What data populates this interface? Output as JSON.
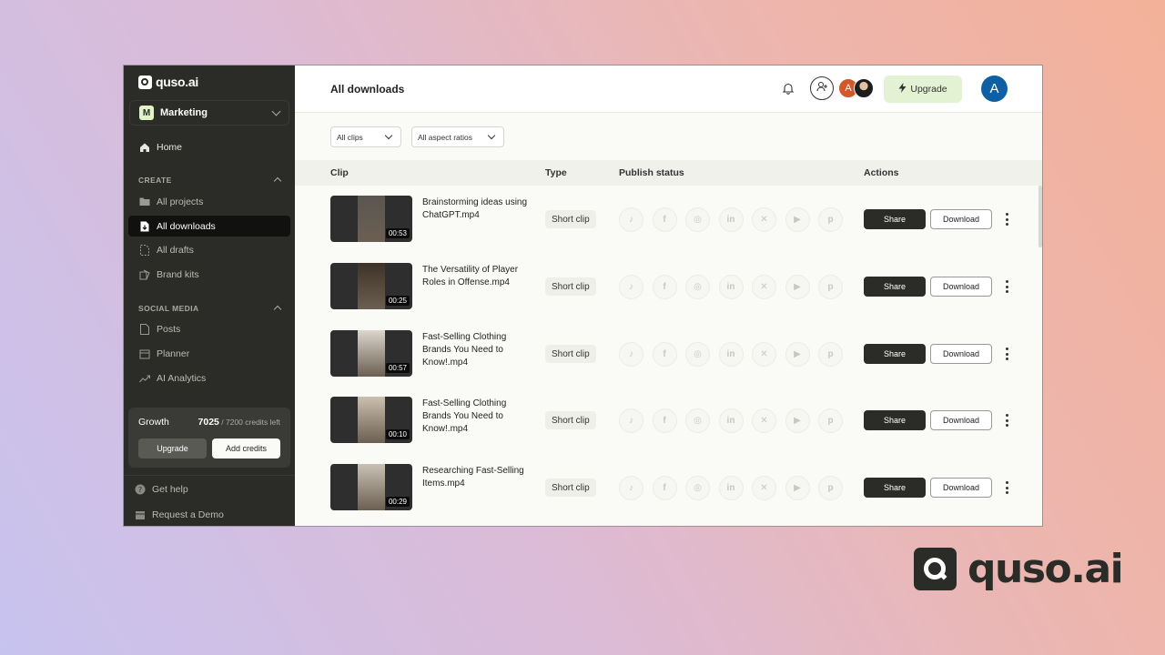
{
  "app": {
    "logo_text": "quso.ai"
  },
  "sidebar": {
    "workspace": {
      "initial": "M",
      "name": "Marketing"
    },
    "home_label": "Home",
    "create_section": "CREATE",
    "create_items": [
      {
        "label": "All projects",
        "icon": "folder-icon"
      },
      {
        "label": "All downloads",
        "icon": "download-file-icon",
        "active": true
      },
      {
        "label": "All drafts",
        "icon": "draft-icon"
      },
      {
        "label": "Brand kits",
        "icon": "brand-kit-icon"
      }
    ],
    "social_section": "SOCIAL MEDIA",
    "social_items": [
      {
        "label": "Posts",
        "icon": "posts-icon"
      },
      {
        "label": "Planner",
        "icon": "calendar-icon"
      },
      {
        "label": "AI Analytics",
        "icon": "analytics-icon"
      }
    ],
    "plan": {
      "name": "Growth",
      "credits_used": "7025",
      "credits_rest": "/ 7200 credits left",
      "upgrade_label": "Upgrade",
      "add_credits_label": "Add credits"
    },
    "footer": [
      {
        "label": "Get help",
        "icon": "help-icon"
      },
      {
        "label": "Request a Demo",
        "icon": "calendar-icon"
      }
    ]
  },
  "header": {
    "title": "All downloads",
    "avatar_a_initial": "A",
    "upgrade_label": "Upgrade",
    "user_initial": "A"
  },
  "filters": {
    "clips": "All clips",
    "aspect": "All aspect ratios"
  },
  "table": {
    "headers": {
      "clip": "Clip",
      "type": "Type",
      "publish": "Publish status",
      "actions": "Actions"
    },
    "platforms": [
      "tiktok-icon",
      "facebook-icon",
      "instagram-icon",
      "linkedin-icon",
      "x-icon",
      "youtube-shorts-icon",
      "pinterest-icon"
    ],
    "share_label": "Share",
    "download_label": "Download",
    "rows": [
      {
        "name": "Brainstorming ideas using ChatGPT.mp4",
        "duration": "00:53",
        "type": "Short clip"
      },
      {
        "name": "The Versatility of Player Roles in Offense.mp4",
        "duration": "00:25",
        "type": "Short clip"
      },
      {
        "name": "Fast-Selling Clothing Brands You Need to Know!.mp4",
        "duration": "00:57",
        "type": "Short clip"
      },
      {
        "name": "Fast-Selling Clothing Brands You Need to Know!.mp4",
        "duration": "00:10",
        "type": "Short clip"
      },
      {
        "name": "Researching Fast-Selling Items.mp4",
        "duration": "00:29",
        "type": "Short clip"
      }
    ]
  },
  "brand": {
    "text": "quso.ai"
  },
  "colors": {
    "sidebar_bg": "#2b2b27",
    "upgrade_bg": "#e3f2d2",
    "user_avatar": "#0e5fa3"
  }
}
